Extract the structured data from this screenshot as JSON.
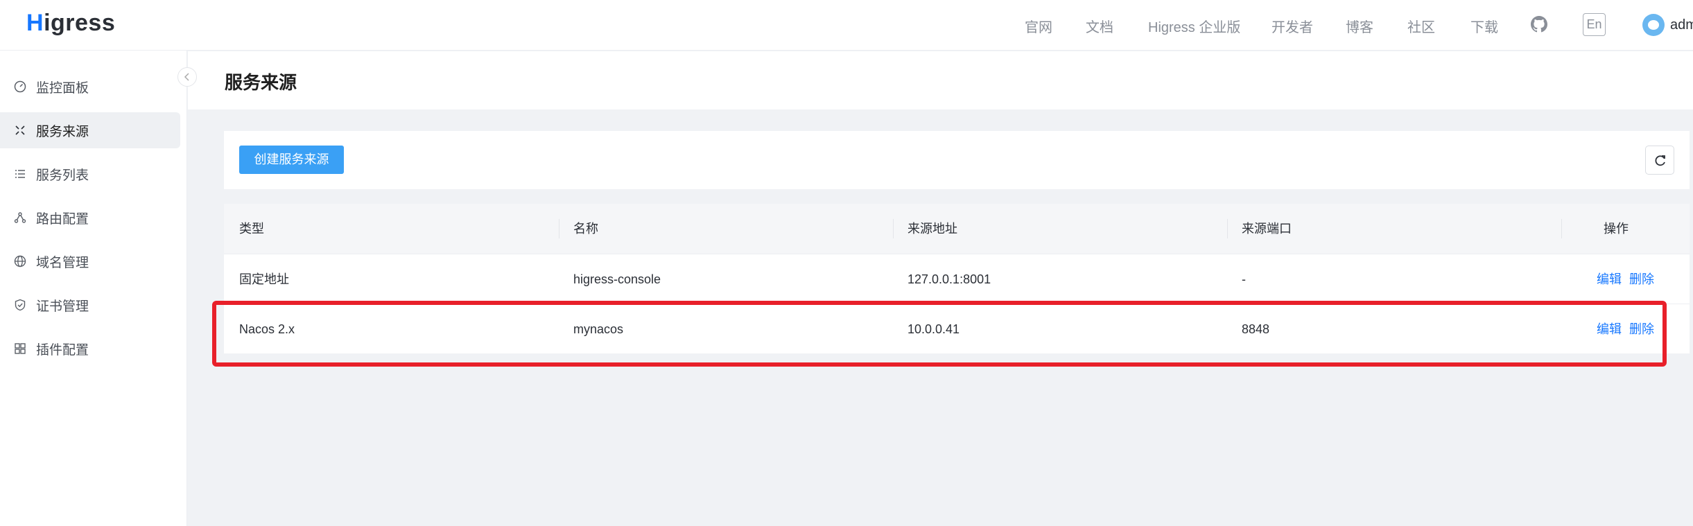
{
  "header": {
    "logo": "Higress",
    "nav": [
      "官网",
      "文档",
      "Higress 企业版",
      "开发者",
      "博客",
      "社区",
      "下载"
    ],
    "lang": "En",
    "user": "adm"
  },
  "sidebar": {
    "items": [
      {
        "label": "监控面板",
        "icon": "dashboard-icon"
      },
      {
        "label": "服务来源",
        "icon": "service-source-icon",
        "active": true
      },
      {
        "label": "服务列表",
        "icon": "list-icon"
      },
      {
        "label": "路由配置",
        "icon": "route-icon"
      },
      {
        "label": "域名管理",
        "icon": "globe-icon"
      },
      {
        "label": "证书管理",
        "icon": "shield-icon"
      },
      {
        "label": "插件配置",
        "icon": "plugin-icon"
      }
    ]
  },
  "page": {
    "title": "服务来源",
    "create_button": "创建服务来源"
  },
  "table": {
    "columns": [
      "类型",
      "名称",
      "来源地址",
      "来源端口",
      "操作"
    ],
    "rows": [
      {
        "type": "固定地址",
        "name": "higress-console",
        "address": "127.0.0.1:8001",
        "port": "-",
        "edit": "编辑",
        "delete": "删除"
      },
      {
        "type": "Nacos 2.x",
        "name": "mynacos",
        "address": "10.0.0.41",
        "port": "8848",
        "edit": "编辑",
        "delete": "删除"
      }
    ]
  },
  "colors": {
    "accent": "#1677ff",
    "button": "#3aa0f5",
    "highlight": "#e8202a"
  }
}
